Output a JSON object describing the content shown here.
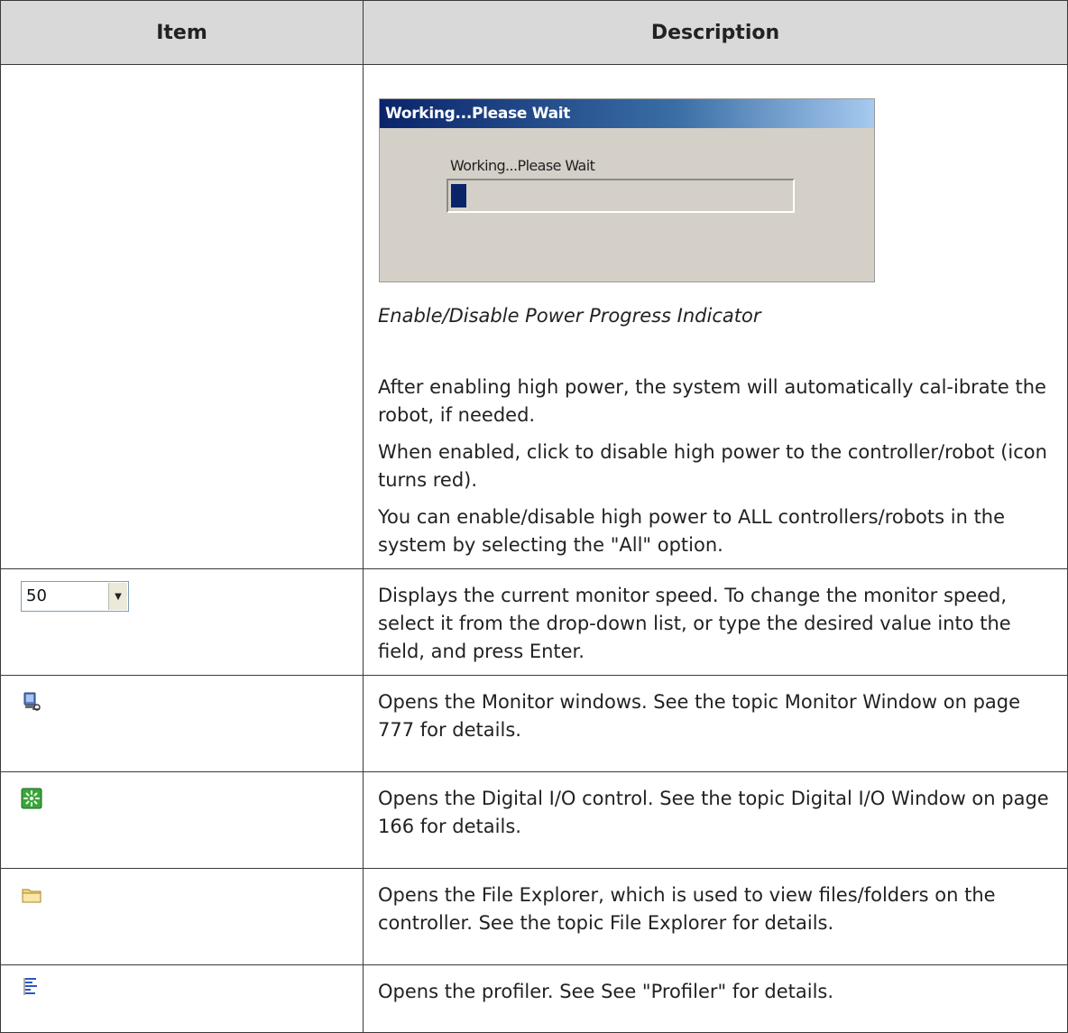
{
  "table": {
    "headers": [
      "Item",
      "Description"
    ],
    "rows": [
      {
        "dialog": {
          "title": "Working...Please Wait",
          "label": "Working...Please Wait",
          "progress_fraction": 0.045
        },
        "caption": "Enable/Disable Power Progress Indicator",
        "paragraphs": [
          "After enabling high power, the system will automatically cal-ibrate the robot, if needed.",
          "When enabled, click to disable high power to the controller/robot (icon turns red).",
          "You can enable/disable high power to ALL controllers/robots in the system by selecting the \"All\" option."
        ]
      },
      {
        "combo_value": "50",
        "text": "Displays the current monitor speed. To change the monitor speed, select it from the drop-down list, or type the desired value into the field, and press Enter."
      },
      {
        "icon": "monitor-window-icon",
        "text": "Opens the Monitor windows. See the topic Monitor Window on page 777 for details."
      },
      {
        "icon": "digital-io-icon",
        "text": "Opens the Digital I/O control. See the topic Digital I/O Window on page 166 for details."
      },
      {
        "icon": "folder-icon",
        "text": "Opens the File Explorer, which is used to view files/folders on the controller. See the topic File Explorer for details."
      },
      {
        "icon": "profiler-icon",
        "text": "Opens the profiler. See See \"Profiler\" for details."
      }
    ]
  },
  "colors": {
    "header_bg": "#d9d9d9",
    "border": "#3a3a3a",
    "dialog_bg": "#d4d0c8",
    "progress_fill": "#0a246a"
  }
}
